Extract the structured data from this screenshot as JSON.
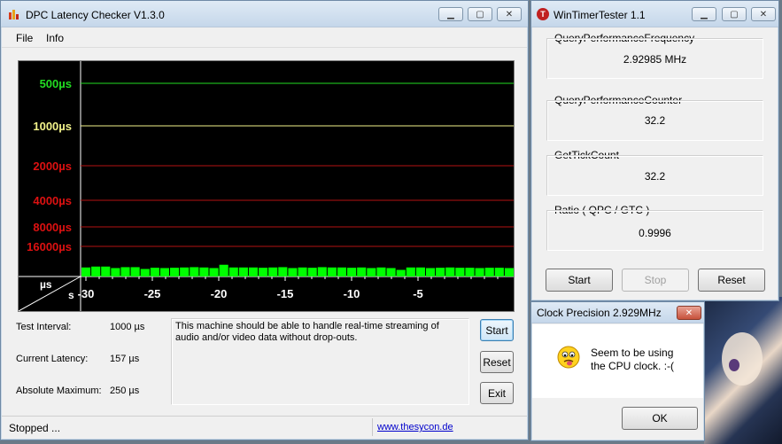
{
  "dpc": {
    "title": "DPC Latency Checker V1.3.0",
    "menu": [
      "File",
      "Info"
    ],
    "y_labels": [
      {
        "text": "16000µs",
        "color": "#dd1111"
      },
      {
        "text": "8000µs",
        "color": "#dd1111"
      },
      {
        "text": "4000µs",
        "color": "#dd1111"
      },
      {
        "text": "2000µs",
        "color": "#dd1111"
      },
      {
        "text": "1000µs",
        "color": "#f2f28a"
      },
      {
        "text": "500µs",
        "color": "#22dd22"
      }
    ],
    "axis_corner_top": "µs",
    "axis_corner_bottom": "s",
    "x_ticks": [
      "-30",
      "-25",
      "-20",
      "-15",
      "-10",
      "-5"
    ],
    "bar_color": "#00ff00",
    "stats": [
      {
        "label": "Test Interval:",
        "value": "1000 µs"
      },
      {
        "label": "Current Latency:",
        "value": "157 µs"
      },
      {
        "label": "Absolute Maximum:",
        "value": "250 µs"
      }
    ],
    "message": "This machine should be able to handle real-time streaming of audio and/or video data without drop-outs.",
    "buttons": {
      "start": "Start",
      "reset": "Reset",
      "exit": "Exit"
    },
    "status": "Stopped ...",
    "link": "www.thesycon.de"
  },
  "chart_data": {
    "type": "bar",
    "title": "",
    "xlabel": "s",
    "ylabel": "µs",
    "x_ticks": [
      -30,
      -25,
      -20,
      -15,
      -10,
      -5
    ],
    "y_ticks": [
      500,
      1000,
      2000,
      4000,
      8000,
      16000
    ],
    "yscale": "log",
    "values": [
      150,
      165,
      165,
      140,
      155,
      155,
      125,
      145,
      140,
      145,
      150,
      155,
      150,
      140,
      195,
      150,
      150,
      150,
      145,
      150,
      155,
      140,
      150,
      145,
      155,
      150,
      150,
      145,
      150,
      140,
      150,
      140,
      110,
      150,
      150,
      140,
      145,
      150,
      145,
      145,
      140,
      145,
      145,
      140
    ]
  },
  "wtt": {
    "title": "WinTimerTester 1.1",
    "groups": [
      {
        "label": "QueryPerformanceFrequency",
        "value": "2.92985 MHz"
      },
      {
        "label": "QueryPerformanceCounter",
        "value": "32.2"
      },
      {
        "label": "GetTickCount",
        "value": "32.2"
      },
      {
        "label": "Ratio  ( QPC / GTC )",
        "value": "0.9996"
      }
    ],
    "buttons": {
      "start": "Start",
      "stop": "Stop",
      "reset": "Reset"
    }
  },
  "dialog": {
    "title": "Clock Precision 2.929MHz",
    "message_line1": "Seem to be using",
    "message_line2": "the CPU clock. :-(",
    "ok": "OK"
  }
}
